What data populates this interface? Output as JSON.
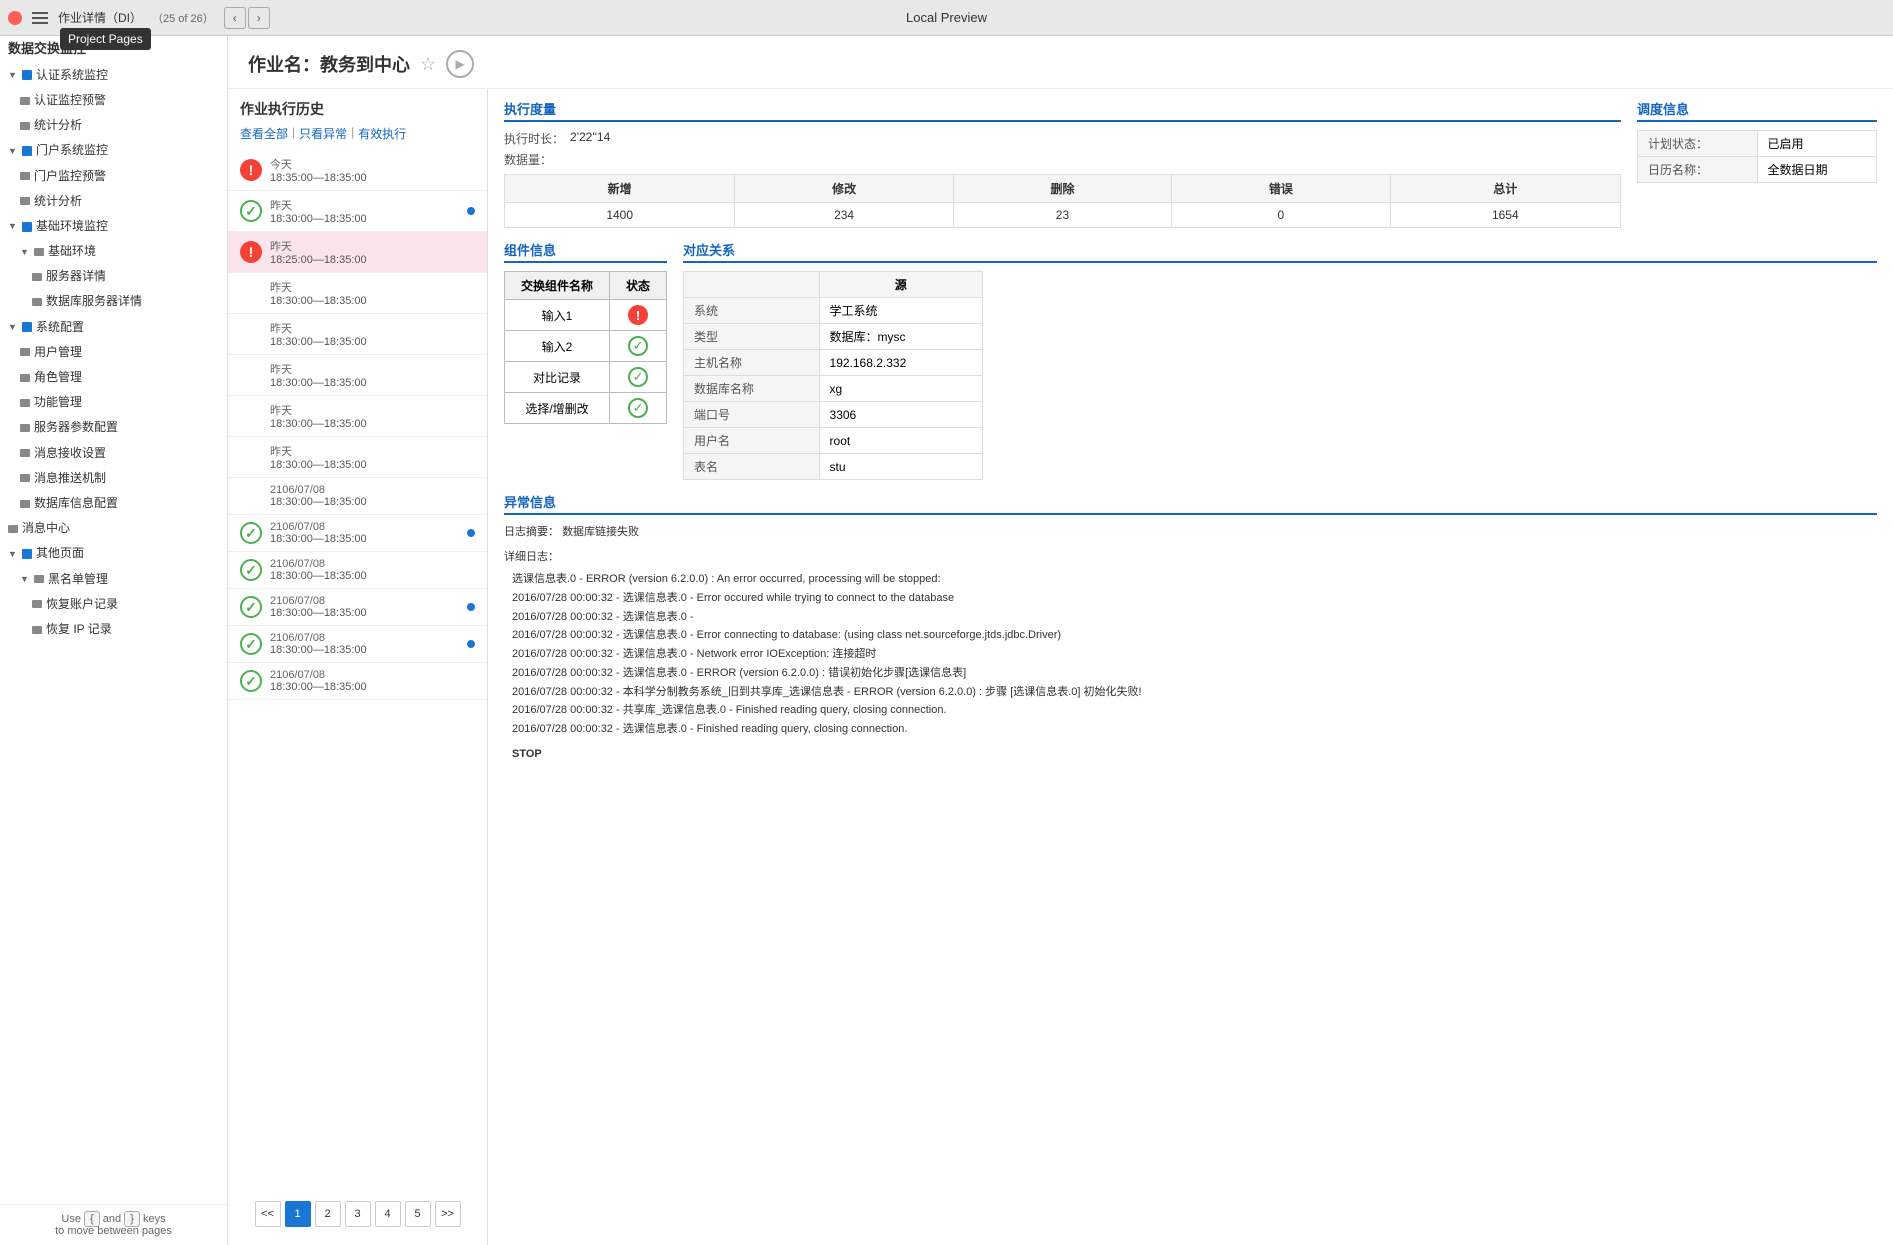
{
  "topbar": {
    "title": "作业详情（DI）",
    "page_count": "（25 of 26）",
    "center_title": "Local Preview",
    "project_pages_tooltip": "Project Pages"
  },
  "sidebar": {
    "title": "数据交换监控",
    "items": [
      {
        "id": "auth-monitor",
        "label": "认证系统监控",
        "level": 1,
        "type": "group",
        "expanded": true
      },
      {
        "id": "auth-alert",
        "label": "认证监控预警",
        "level": 2,
        "type": "page"
      },
      {
        "id": "auth-stats",
        "label": "统计分析",
        "level": 2,
        "type": "page"
      },
      {
        "id": "portal-monitor",
        "label": "门户系统监控",
        "level": 1,
        "type": "group",
        "expanded": true
      },
      {
        "id": "portal-alert",
        "label": "门户监控预警",
        "level": 2,
        "type": "page"
      },
      {
        "id": "portal-stats",
        "label": "统计分析",
        "level": 2,
        "type": "page"
      },
      {
        "id": "infra-monitor",
        "label": "基础环境监控",
        "level": 1,
        "type": "group",
        "expanded": true
      },
      {
        "id": "infra-env",
        "label": "基础环境",
        "level": 2,
        "type": "group",
        "expanded": true
      },
      {
        "id": "server-detail",
        "label": "服务器详情",
        "level": 3,
        "type": "page"
      },
      {
        "id": "db-server-detail",
        "label": "数据库服务器详情",
        "level": 3,
        "type": "page"
      },
      {
        "id": "sys-config",
        "label": "系统配置",
        "level": 1,
        "type": "group",
        "expanded": true
      },
      {
        "id": "user-mgmt",
        "label": "用户管理",
        "level": 2,
        "type": "page"
      },
      {
        "id": "role-mgmt",
        "label": "角色管理",
        "level": 2,
        "type": "page"
      },
      {
        "id": "func-mgmt",
        "label": "功能管理",
        "level": 2,
        "type": "page"
      },
      {
        "id": "server-params",
        "label": "服务器参数配置",
        "level": 2,
        "type": "page"
      },
      {
        "id": "msg-receive",
        "label": "消息接收设置",
        "level": 2,
        "type": "page"
      },
      {
        "id": "msg-push",
        "label": "消息推送机制",
        "level": 2,
        "type": "page"
      },
      {
        "id": "db-config",
        "label": "数据库信息配置",
        "level": 2,
        "type": "page"
      },
      {
        "id": "msg-center",
        "label": "消息中心",
        "level": 1,
        "type": "page"
      },
      {
        "id": "other-pages",
        "label": "其他页面",
        "level": 1,
        "type": "group",
        "expanded": true
      },
      {
        "id": "blacklist-mgmt",
        "label": "黑名单管理",
        "level": 2,
        "type": "group",
        "expanded": true
      },
      {
        "id": "restore-account",
        "label": "恢复账户记录",
        "level": 3,
        "type": "page"
      },
      {
        "id": "restore-ip",
        "label": "恢复 IP 记录",
        "level": 3,
        "type": "page"
      }
    ],
    "bottom_text": "Use",
    "bottom_keys": [
      "{",
      "}"
    ],
    "bottom_text2": "and",
    "bottom_text3": "keys",
    "bottom_text4": "to move between",
    "bottom_text5": "pages"
  },
  "content": {
    "title": "作业名：教务到中心",
    "job_history": {
      "title": "作业执行历史",
      "filters": [
        "查看全部",
        "只看异常",
        "有效执行"
      ],
      "items": [
        {
          "date": "今天",
          "time": "18:35:00—18:35:00",
          "status": "error",
          "dot": false,
          "selected": false
        },
        {
          "date": "昨天",
          "time": "18:30:00—18:35:00",
          "status": "success",
          "dot": true,
          "selected": false
        },
        {
          "date": "昨天",
          "time": "18:25:00—18:35:00",
          "status": "error",
          "dot": false,
          "selected": true
        },
        {
          "date": "昨天",
          "time": "18:30:00—18:35:00",
          "status": "none",
          "dot": false,
          "selected": false
        },
        {
          "date": "昨天",
          "time": "18:30:00—18:35:00",
          "status": "none",
          "dot": false,
          "selected": false
        },
        {
          "date": "昨天",
          "time": "18:30:00—18:35:00",
          "status": "none",
          "dot": false,
          "selected": false
        },
        {
          "date": "昨天",
          "time": "18:30:00—18:35:00",
          "status": "none",
          "dot": false,
          "selected": false
        },
        {
          "date": "昨天",
          "time": "18:30:00—18:35:00",
          "status": "none",
          "dot": false,
          "selected": false
        },
        {
          "date": "2106/07/08",
          "time": "18:30:00—18:35:00",
          "status": "none",
          "dot": false,
          "selected": false
        },
        {
          "date": "2106/07/08",
          "time": "18:30:00—18:35:00",
          "status": "success",
          "dot": true,
          "selected": false
        },
        {
          "date": "2106/07/08",
          "time": "18:30:00—18:35:00",
          "status": "success",
          "dot": false,
          "selected": false
        },
        {
          "date": "2106/07/08",
          "time": "18:30:00—18:35:00",
          "status": "success",
          "dot": true,
          "selected": false
        },
        {
          "date": "2106/07/08",
          "time": "18:30:00—18:35:00",
          "status": "success",
          "dot": true,
          "selected": false
        },
        {
          "date": "2106/07/08",
          "time": "18:30:00—18:35:00",
          "status": "success",
          "dot": false,
          "selected": false
        }
      ],
      "pagination": {
        "prev_prev": "<<",
        "prev": "<",
        "pages": [
          "1",
          "2",
          "3",
          "4",
          "5"
        ],
        "next": ">",
        "next_next": ">>",
        "active_page": "1"
      }
    },
    "execution": {
      "title": "执行度量",
      "duration_label": "执行时长：",
      "duration_value": "2'22''14",
      "data_label": "数据量：",
      "table_headers": [
        "新增",
        "修改",
        "删除",
        "错误",
        "总计"
      ],
      "table_values": [
        "1400",
        "234",
        "23",
        "0",
        "1654"
      ]
    },
    "config": {
      "title": "调度信息",
      "rows": [
        {
          "label": "计划状态：",
          "value": "已启用"
        },
        {
          "label": "日历名称：",
          "value": "全数据日期"
        }
      ]
    },
    "components": {
      "title": "组件信息",
      "headers": [
        "交换组件名称",
        "状态"
      ],
      "rows": [
        {
          "name": "输入1",
          "status": "error"
        },
        {
          "name": "输入2",
          "status": "success"
        },
        {
          "name": "对比记录",
          "status": "success"
        },
        {
          "name": "选择/增删改",
          "status": "success"
        }
      ]
    },
    "relation": {
      "title": "对应关系",
      "headers": [
        "系统",
        "源",
        "学工系统"
      ],
      "rows": [
        {
          "label": "系统",
          "value": "学工系统"
        },
        {
          "label": "类型",
          "value": "数据库：mysc"
        },
        {
          "label": "主机名称",
          "value": "192.168.2.332"
        },
        {
          "label": "数据库名称",
          "value": "xg"
        },
        {
          "label": "端口号",
          "value": "3306"
        },
        {
          "label": "用户名",
          "value": "root"
        },
        {
          "label": "表名",
          "value": "stu"
        }
      ]
    },
    "error": {
      "title": "异常信息",
      "summary_label": "日志摘要：",
      "summary_value": "数据库链接失败",
      "detail_label": "详细日志：",
      "log_lines": [
        "选课信息表.0 - ERROR (version 6.2.0.0) : An error occurred, processing will be stopped:",
        "2016/07/28 00:00:32 - 选课信息表.0 - Error occured while trying to connect to the database",
        "2016/07/28 00:00:32 - 选课信息表.0 -",
        "2016/07/28 00:00:32 - 选课信息表.0 - Error connecting to database: (using class net.sourceforge.jtds.jdbc.Driver)",
        "2016/07/28 00:00:32 - 选课信息表.0 - Network error IOException: 连接超时",
        "2016/07/28 00:00:32 - 选课信息表.0 - ERROR (version 6.2.0.0) : 错误初始化步骤[选课信息表]",
        "2016/07/28 00:00:32 - 本科学分制教务系统_旧到共享库_选课信息表 - ERROR (version 6.2.0.0) : 步骤 [选课信息表.0] 初始化失败!",
        "2016/07/28 00:00:32 - 共享库_选课信息表.0 - Finished reading query, closing connection.",
        "2016/07/28 00:00:32 - 选课信息表.0 - Finished reading query, closing connection.",
        "STOP"
      ]
    }
  }
}
